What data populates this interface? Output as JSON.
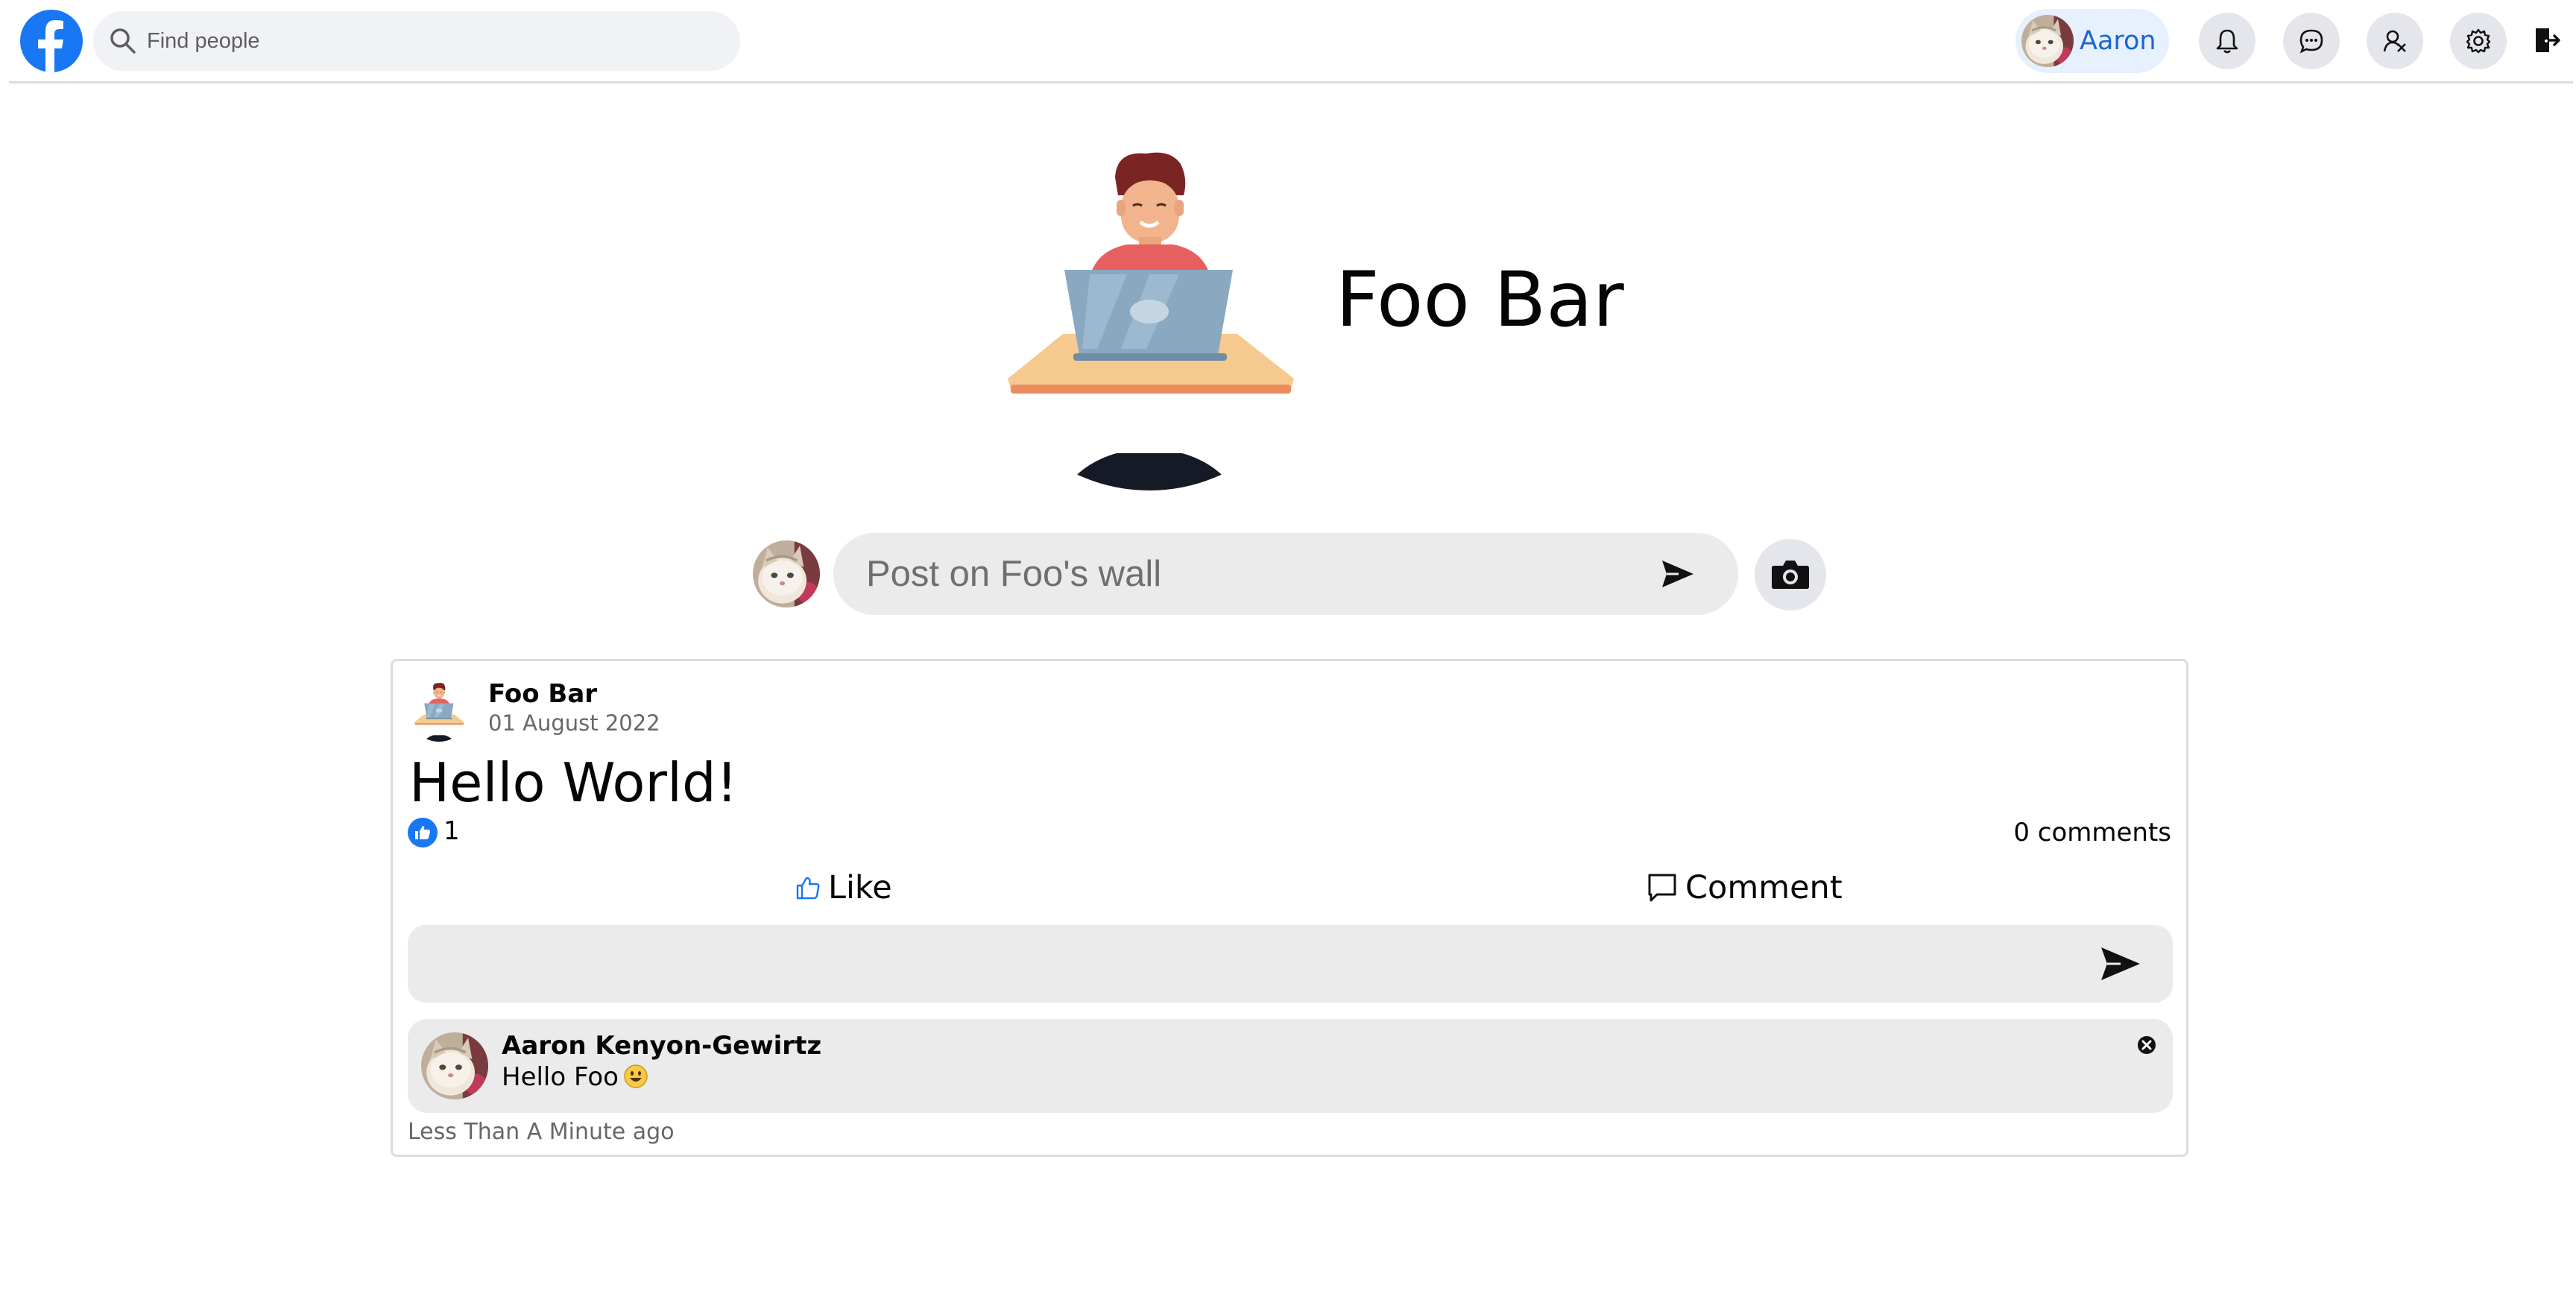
{
  "colors": {
    "brand_blue": "#1877f2",
    "chip_text": "#1b66d2",
    "input_bg": "#ebebeb",
    "muted_text": "#65676b"
  },
  "header": {
    "logo_icon": "facebook-f-icon",
    "search": {
      "placeholder": "Find people",
      "value": "",
      "icon": "search-icon"
    },
    "user_chip": {
      "name": "Aaron",
      "avatar": "cat-photo"
    },
    "nav_icons": [
      "bell-icon",
      "messenger-icon",
      "friends-icon",
      "gear-icon",
      "logout-icon"
    ]
  },
  "profile": {
    "name": "Foo Bar",
    "avatar": "person-at-laptop-illustration"
  },
  "composer": {
    "placeholder": "Post on Foo's wall",
    "value": "",
    "send_icon": "send-icon",
    "camera_icon": "camera-icon"
  },
  "post": {
    "author": "Foo Bar",
    "date": "01 August 2022",
    "text": "Hello World!",
    "like_count": "1",
    "comments_label": "0 comments",
    "actions": {
      "like_label": "Like",
      "comment_label": "Comment"
    },
    "reply": {
      "placeholder": "",
      "value": ""
    },
    "comments": [
      {
        "author": "Aaron Kenyon-Gewirtz",
        "text": "Hello Foo",
        "emoji": "smiling-face-emoji",
        "time": "Less Than A Minute ago"
      }
    ]
  }
}
